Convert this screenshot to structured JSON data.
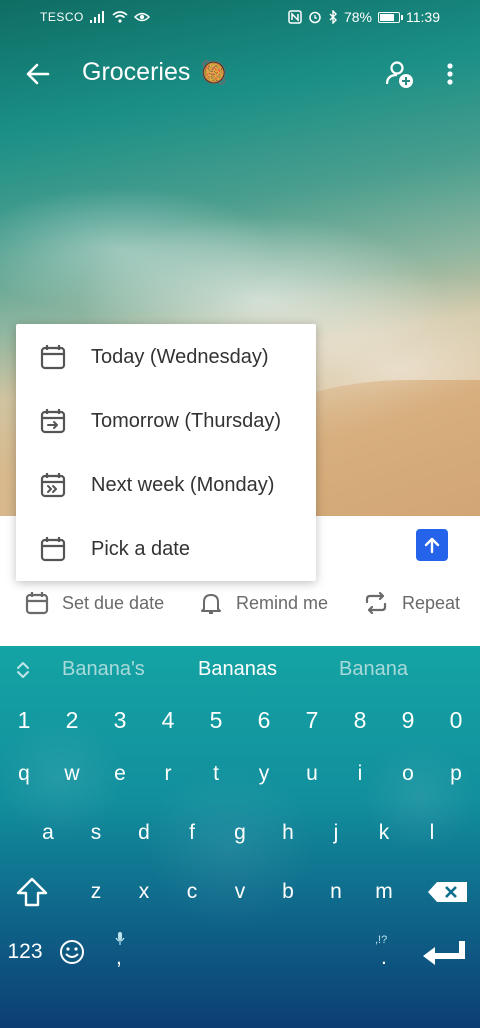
{
  "status_bar": {
    "carrier": "TESCO",
    "battery": "78%",
    "battery_level": 0.78,
    "time": "11:39"
  },
  "app_bar": {
    "title": "Groceries",
    "title_emoji": "🥘",
    "icons": [
      "back-arrow-icon",
      "add-user-icon",
      "more-vertical-icon"
    ]
  },
  "due_date_menu": {
    "items": [
      {
        "label": "Today (Wednesday)",
        "icon": "calendar-today-icon"
      },
      {
        "label": "Tomorrow (Thursday)",
        "icon": "calendar-arrow-icon"
      },
      {
        "label": "Next week (Monday)",
        "icon": "calendar-next-week-icon"
      },
      {
        "label": "Pick a date",
        "icon": "calendar-pick-icon"
      }
    ]
  },
  "quick_actions": {
    "due_date": "Set due date",
    "remind": "Remind me",
    "repeat": "Repeat"
  },
  "keyboard": {
    "suggestions": [
      "Banana's",
      "Bananas",
      "Banana"
    ],
    "numbers": [
      "1",
      "2",
      "3",
      "4",
      "5",
      "6",
      "7",
      "8",
      "9",
      "0"
    ],
    "row1": [
      "q",
      "w",
      "e",
      "r",
      "t",
      "y",
      "u",
      "i",
      "o",
      "p"
    ],
    "row2": [
      "a",
      "s",
      "d",
      "f",
      "g",
      "h",
      "j",
      "k",
      "l"
    ],
    "row3": [
      "z",
      "x",
      "c",
      "v",
      "b",
      "n",
      "m"
    ],
    "mode_key": "123",
    "comma": ",",
    "period": ".",
    "punct_hint": ",!?"
  },
  "colors": {
    "accent": "#2563eb",
    "menu_text": "#333333",
    "action_text": "#6a6a6a"
  }
}
